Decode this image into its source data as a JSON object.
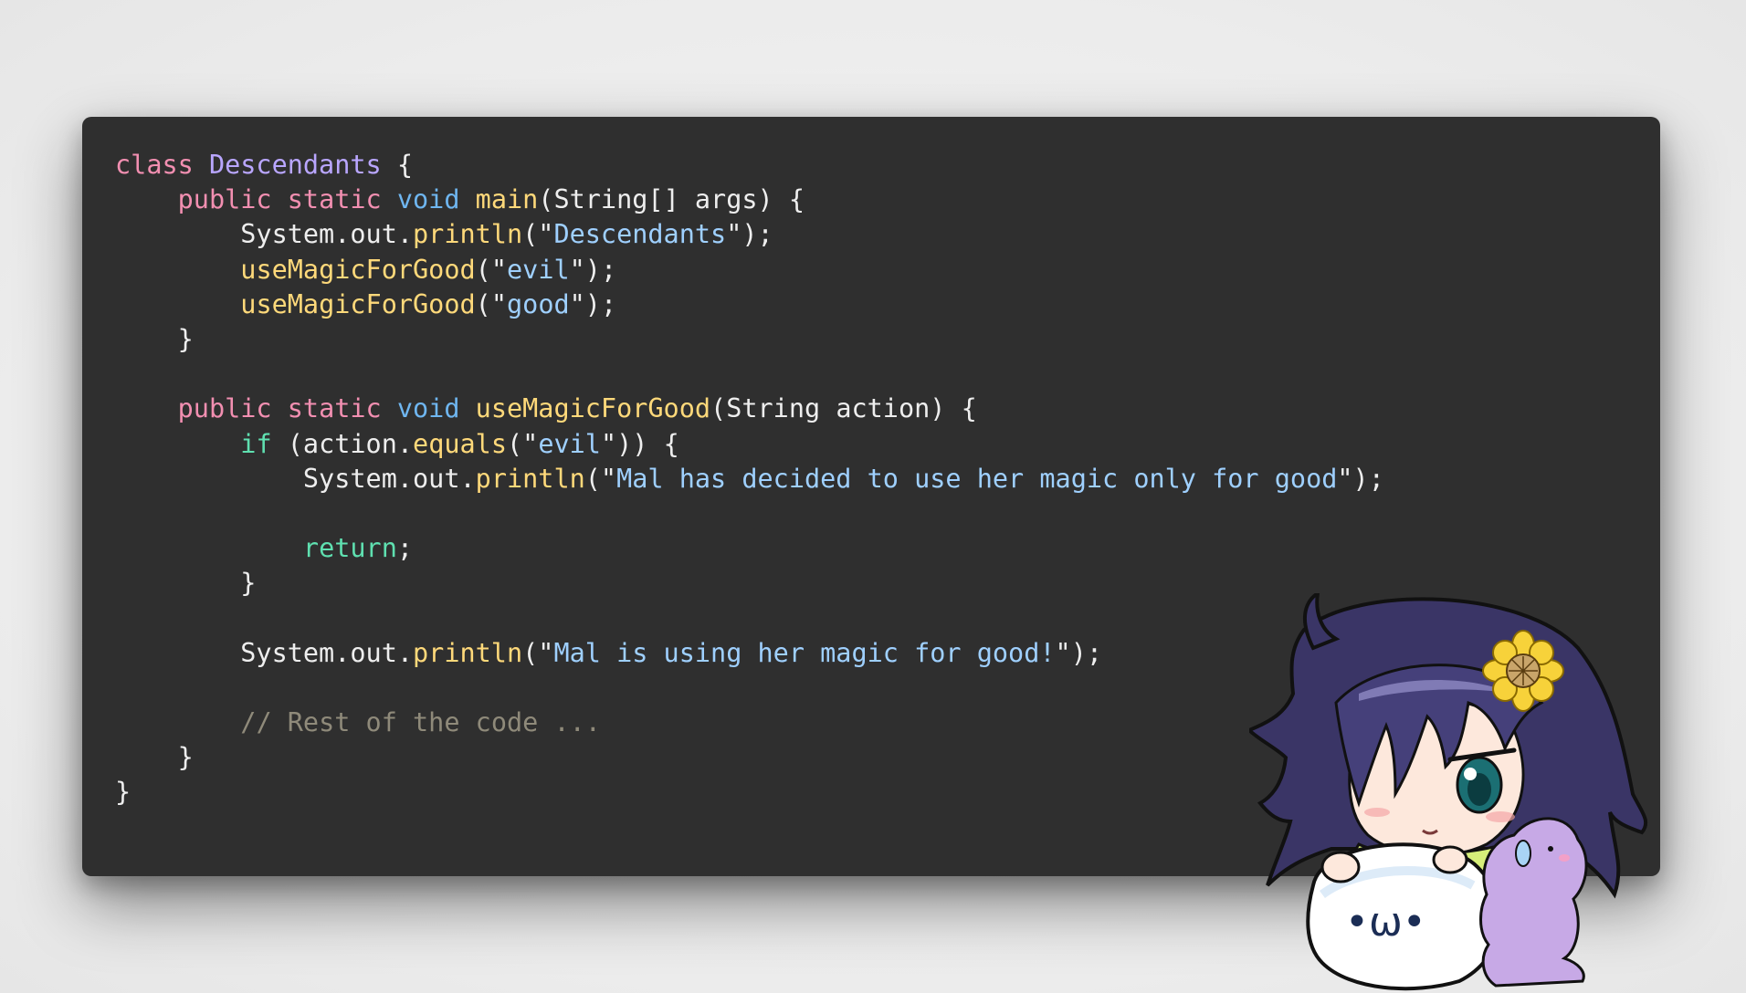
{
  "code_lines": [
    [
      {
        "t": "class ",
        "c": "kw-pink"
      },
      {
        "t": "Descendants",
        "c": "cls"
      },
      {
        "t": " {",
        "c": "plain"
      }
    ],
    [
      {
        "t": "    ",
        "c": "plain"
      },
      {
        "t": "public static ",
        "c": "kw-pink"
      },
      {
        "t": "void ",
        "c": "kw-blue"
      },
      {
        "t": "main",
        "c": "fn"
      },
      {
        "t": "(String[] args) {",
        "c": "plain"
      }
    ],
    [
      {
        "t": "        System.out.",
        "c": "plain"
      },
      {
        "t": "println",
        "c": "fn"
      },
      {
        "t": "(\"",
        "c": "plain"
      },
      {
        "t": "Descendants",
        "c": "str"
      },
      {
        "t": "\");",
        "c": "plain"
      }
    ],
    [
      {
        "t": "        ",
        "c": "plain"
      },
      {
        "t": "useMagicForGood",
        "c": "fn"
      },
      {
        "t": "(\"",
        "c": "plain"
      },
      {
        "t": "evil",
        "c": "str"
      },
      {
        "t": "\");",
        "c": "plain"
      }
    ],
    [
      {
        "t": "        ",
        "c": "plain"
      },
      {
        "t": "useMagicForGood",
        "c": "fn"
      },
      {
        "t": "(\"",
        "c": "plain"
      },
      {
        "t": "good",
        "c": "str"
      },
      {
        "t": "\");",
        "c": "plain"
      }
    ],
    [
      {
        "t": "    }",
        "c": "plain"
      }
    ],
    [
      {
        "t": "",
        "c": "plain"
      }
    ],
    [
      {
        "t": "    ",
        "c": "plain"
      },
      {
        "t": "public static ",
        "c": "kw-pink"
      },
      {
        "t": "void ",
        "c": "kw-blue"
      },
      {
        "t": "useMagicForGood",
        "c": "fn"
      },
      {
        "t": "(String action) {",
        "c": "plain"
      }
    ],
    [
      {
        "t": "        ",
        "c": "plain"
      },
      {
        "t": "if ",
        "c": "kw-green"
      },
      {
        "t": "(action.",
        "c": "plain"
      },
      {
        "t": "equals",
        "c": "fn"
      },
      {
        "t": "(\"",
        "c": "plain"
      },
      {
        "t": "evil",
        "c": "str"
      },
      {
        "t": "\")) {",
        "c": "plain"
      }
    ],
    [
      {
        "t": "            System.out.",
        "c": "plain"
      },
      {
        "t": "println",
        "c": "fn"
      },
      {
        "t": "(\"",
        "c": "plain"
      },
      {
        "t": "Mal has decided to use her magic only for good",
        "c": "str"
      },
      {
        "t": "\");",
        "c": "plain"
      }
    ],
    [
      {
        "t": "",
        "c": "plain"
      }
    ],
    [
      {
        "t": "            ",
        "c": "plain"
      },
      {
        "t": "return",
        "c": "kw-green"
      },
      {
        "t": ";",
        "c": "plain"
      }
    ],
    [
      {
        "t": "        }",
        "c": "plain"
      }
    ],
    [
      {
        "t": "",
        "c": "plain"
      }
    ],
    [
      {
        "t": "        System.out.",
        "c": "plain"
      },
      {
        "t": "println",
        "c": "fn"
      },
      {
        "t": "(\"",
        "c": "plain"
      },
      {
        "t": "Mal is using her magic for good!",
        "c": "str"
      },
      {
        "t": "\");",
        "c": "plain"
      }
    ],
    [
      {
        "t": "",
        "c": "plain"
      }
    ],
    [
      {
        "t": "        ",
        "c": "plain"
      },
      {
        "t": "// Rest of the code ...",
        "c": "comment"
      }
    ],
    [
      {
        "t": "    }",
        "c": "plain"
      }
    ],
    [
      {
        "t": "}",
        "c": "plain"
      }
    ]
  ],
  "colors": {
    "background": "#efefef",
    "card": "#2f2f2f",
    "keyword_pink": "#f28fb1",
    "keyword_blue": "#6fb6f0",
    "keyword_green": "#5fe0b0",
    "class_name": "#b9a6ff",
    "function": "#ffd97a",
    "string": "#9fd0ff",
    "comment": "#8f8a7a"
  },
  "mascot": {
    "icon": "anime-girl-mascot-icon",
    "face_text": "•ω•"
  }
}
